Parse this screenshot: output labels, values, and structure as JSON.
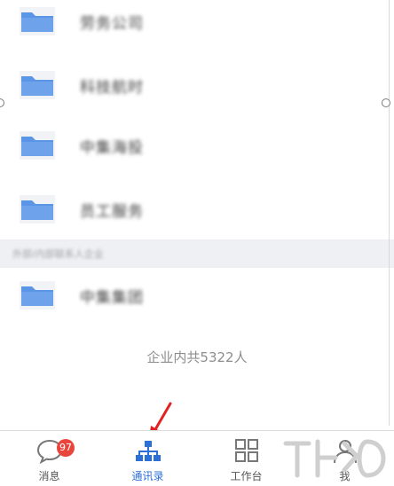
{
  "list": {
    "items": [
      {
        "label": "劳务公司"
      },
      {
        "label": "科技航时"
      },
      {
        "label": "中集海投"
      },
      {
        "label": "员工服务"
      }
    ],
    "section_header": "外部/内部联系人企业",
    "section_items": [
      {
        "label": "中集集团"
      }
    ],
    "count_text": "企业内共5322人"
  },
  "tabbar": {
    "tabs": [
      {
        "label": "消息",
        "badge": "97"
      },
      {
        "label": "通讯录"
      },
      {
        "label": "工作台"
      },
      {
        "label": "我"
      }
    ]
  },
  "colors": {
    "accent": "#2c6fd6",
    "folder": "#5b95e6",
    "badge": "#e8453c",
    "annotation_arrow": "#e22222"
  },
  "icons": {
    "row": "folder-icon",
    "tabs": [
      "chat-bubble-icon",
      "org-chart-icon",
      "grid-icon",
      "person-icon"
    ]
  }
}
